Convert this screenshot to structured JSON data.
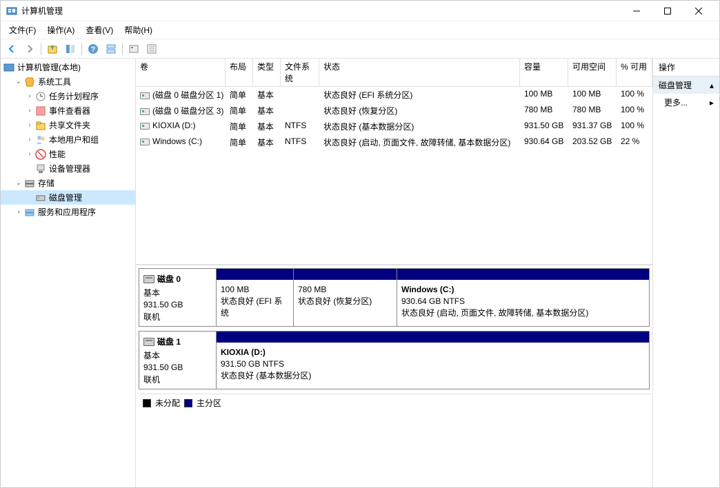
{
  "window": {
    "title": "计算机管理"
  },
  "menu": {
    "file": "文件(F)",
    "action": "操作(A)",
    "view": "查看(V)",
    "help": "帮助(H)"
  },
  "tree": {
    "root": "计算机管理(本地)",
    "system_tools": "系统工具",
    "task_scheduler": "任务计划程序",
    "event_viewer": "事件查看器",
    "shared_folders": "共享文件夹",
    "local_users": "本地用户和组",
    "performance": "性能",
    "device_manager": "设备管理器",
    "storage": "存储",
    "disk_management": "磁盘管理",
    "services": "服务和应用程序"
  },
  "columns": {
    "volume": "卷",
    "layout": "布局",
    "type": "类型",
    "filesystem": "文件系统",
    "status": "状态",
    "capacity": "容量",
    "free": "可用空间",
    "percent": "% 可用"
  },
  "volumes": [
    {
      "name": "(磁盘 0 磁盘分区 1)",
      "layout": "简单",
      "type": "基本",
      "fs": "",
      "status": "状态良好 (EFI 系统分区)",
      "cap": "100 MB",
      "free": "100 MB",
      "pct": "100 %"
    },
    {
      "name": "(磁盘 0 磁盘分区 3)",
      "layout": "简单",
      "type": "基本",
      "fs": "",
      "status": "状态良好 (恢复分区)",
      "cap": "780 MB",
      "free": "780 MB",
      "pct": "100 %"
    },
    {
      "name": "KIOXIA (D:)",
      "layout": "简单",
      "type": "基本",
      "fs": "NTFS",
      "status": "状态良好 (基本数据分区)",
      "cap": "931.50 GB",
      "free": "931.37 GB",
      "pct": "100 %"
    },
    {
      "name": "Windows (C:)",
      "layout": "简单",
      "type": "基本",
      "fs": "NTFS",
      "status": "状态良好 (启动, 页面文件, 故障转储, 基本数据分区)",
      "cap": "930.64 GB",
      "free": "203.52 GB",
      "pct": "22 %"
    }
  ],
  "disks": [
    {
      "name": "磁盘 0",
      "type": "基本",
      "size": "931.50 GB",
      "status": "联机",
      "parts": [
        {
          "title": "",
          "line2": "100 MB",
          "line3": "状态良好 (EFI 系统",
          "width": 112
        },
        {
          "title": "",
          "line2": "780 MB",
          "line3": "状态良好 (恢复分区)",
          "width": 150
        },
        {
          "title": "Windows  (C:)",
          "line2": "930.64 GB NTFS",
          "line3": "状态良好 (启动, 页面文件, 故障转储, 基本数据分区)",
          "width": 0
        }
      ]
    },
    {
      "name": "磁盘 1",
      "type": "基本",
      "size": "931.50 GB",
      "status": "联机",
      "parts": [
        {
          "title": "KIOXIA  (D:)",
          "line2": "931.50 GB NTFS",
          "line3": "状态良好 (基本数据分区)",
          "width": 0
        }
      ]
    }
  ],
  "legend": {
    "unallocated": "未分配",
    "primary": "主分区"
  },
  "actions": {
    "header": "操作",
    "group": "磁盘管理",
    "more": "更多..."
  }
}
